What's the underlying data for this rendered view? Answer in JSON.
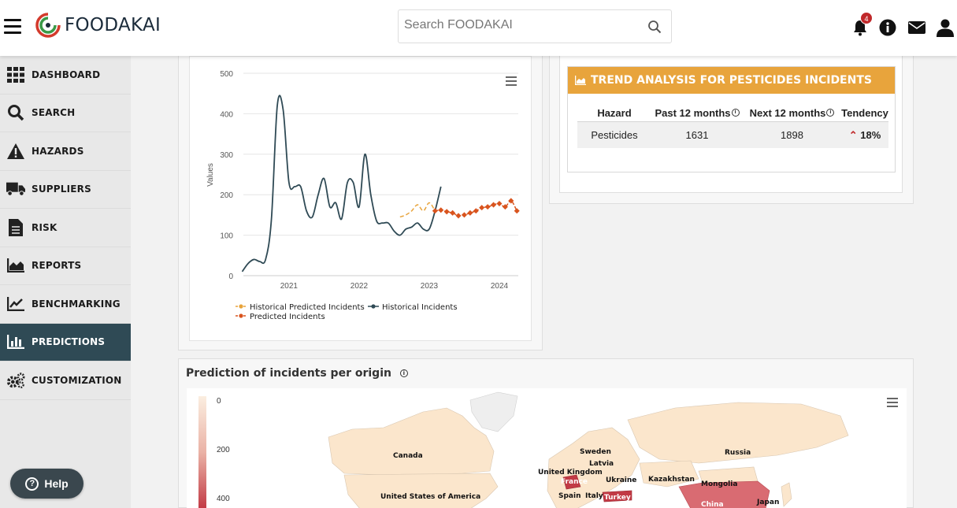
{
  "header": {
    "logo_text": "FOODAKAI",
    "search_placeholder": "Search FOODAKAI",
    "notification_count": "4"
  },
  "sidebar": {
    "items": [
      {
        "label": "DASHBOARD",
        "icon": "grid-icon"
      },
      {
        "label": "SEARCH",
        "icon": "search-icon"
      },
      {
        "label": "HAZARDS",
        "icon": "warning-icon"
      },
      {
        "label": "SUPPLIERS",
        "icon": "truck-icon"
      },
      {
        "label": "RISK",
        "icon": "document-icon"
      },
      {
        "label": "REPORTS",
        "icon": "area-chart-icon"
      },
      {
        "label": "BENCHMARKING",
        "icon": "line-chart-icon"
      },
      {
        "label": "PREDICTIONS",
        "icon": "bar-chart-icon",
        "active": true
      },
      {
        "label": "CUSTOMIZATION",
        "icon": "gears-icon"
      }
    ],
    "help_label": "Help"
  },
  "chart_data": {
    "type": "line",
    "ylabel": "Values",
    "ylim": [
      0,
      500
    ],
    "yticks": [
      "500",
      "400",
      "300",
      "200",
      "100",
      "0"
    ],
    "xticks": [
      "2021",
      "2022",
      "2023",
      "2024"
    ],
    "series": [
      {
        "name": "Historical Predicted Incidents",
        "color": "#e8a43c",
        "style": "dashed",
        "x": [
          "2022-08",
          "2022-09",
          "2022-10",
          "2022-11",
          "2022-12",
          "2023-01",
          "2023-02"
        ],
        "values": [
          145,
          150,
          160,
          175,
          160,
          180,
          160
        ]
      },
      {
        "name": "Historical Incidents",
        "color": "#2f4a55",
        "style": "solid",
        "x": [
          "2020-05",
          "2020-06",
          "2020-07",
          "2020-08",
          "2020-09",
          "2020-10",
          "2020-11",
          "2020-12",
          "2021-01",
          "2021-02",
          "2021-03",
          "2021-04",
          "2021-05",
          "2021-06",
          "2021-07",
          "2021-08",
          "2021-09",
          "2021-10",
          "2021-11",
          "2021-12",
          "2022-01",
          "2022-02",
          "2022-03",
          "2022-04",
          "2022-05",
          "2022-06",
          "2022-07",
          "2022-08",
          "2022-09",
          "2022-10",
          "2022-11",
          "2022-12",
          "2023-01",
          "2023-02",
          "2023-03"
        ],
        "values": [
          10,
          30,
          40,
          35,
          40,
          140,
          420,
          410,
          230,
          220,
          220,
          160,
          145,
          200,
          240,
          170,
          180,
          140,
          230,
          230,
          170,
          300,
          200,
          135,
          130,
          130,
          110,
          100,
          115,
          120,
          130,
          115,
          115,
          160,
          220
        ]
      },
      {
        "name": "Predicted Incidents",
        "color": "#d9541e",
        "style": "dash-dot-markers",
        "x": [
          "2023-02",
          "2023-03",
          "2023-04",
          "2023-05",
          "2023-06",
          "2023-07",
          "2023-08",
          "2023-09",
          "2023-10",
          "2023-11",
          "2023-12",
          "2024-01",
          "2024-02",
          "2024-03",
          "2024-04"
        ],
        "values": [
          160,
          162,
          158,
          155,
          148,
          150,
          155,
          160,
          168,
          170,
          175,
          178,
          170,
          185,
          160
        ]
      }
    ],
    "legend": [
      "Historical Predicted Incidents",
      "Historical Incidents",
      "Predicted Incidents"
    ],
    "legend_position": "bottom"
  },
  "trend": {
    "title": "TREND ANALYSIS FOR PESTICIDES INCIDENTS",
    "columns": [
      "Hazard",
      "Past 12 months",
      "Next 12 months",
      "Tendency"
    ],
    "row": {
      "hazard": "Pesticides",
      "past": "1631",
      "next": "1898",
      "tendency": "18%"
    }
  },
  "map": {
    "title": "Prediction of incidents per origin",
    "scale_labels": [
      "0",
      "200",
      "400"
    ],
    "countries": [
      "Canada",
      "Sweden",
      "Latvia",
      "Russia",
      "United Kingdom",
      "France",
      "Ukraine",
      "Kazakhstan",
      "Mongolia",
      "United States of America",
      "Spain",
      "Italy",
      "Turkey",
      "China",
      "Japan"
    ]
  }
}
